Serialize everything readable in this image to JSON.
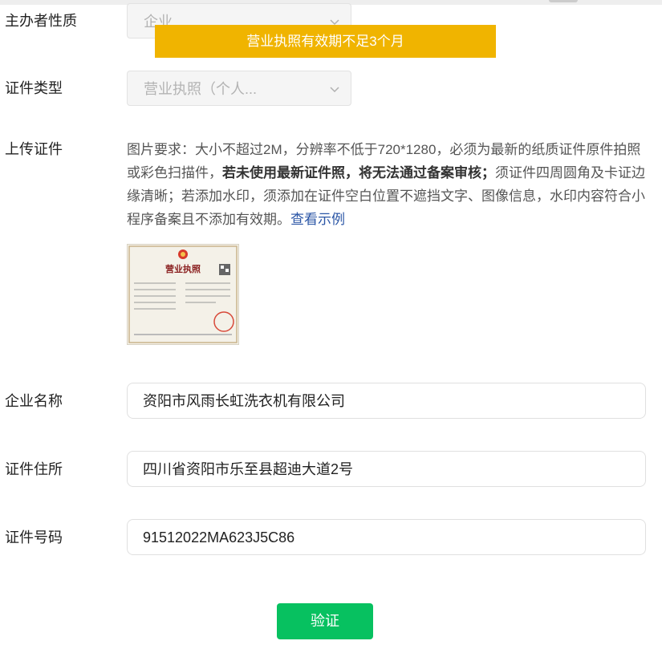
{
  "form": {
    "organizer_type": {
      "label": "主办者性质",
      "value": "企业"
    },
    "cert_type": {
      "label": "证件类型",
      "value": "营业执照（个人..."
    },
    "upload": {
      "label": "上传证件",
      "desc_part1": "图片要求：大小不超过2M，分辨率不低于720*1280，必须为最新的纸质证件原件拍照或彩色扫描件，",
      "desc_bold": "若未使用最新证件照，将无法通过备案审核；",
      "desc_part2": "须证件四周圆角及卡证边缘清晰；若添加水印，须添加在证件空白位置不遮挡文字、图像信息，水印内容符合小程序备案且不添加有效期。",
      "example_link": "查看示例",
      "thumb_title": "营业执照"
    },
    "company_name": {
      "label": "企业名称",
      "value": "资阳市风雨长虹洗衣机有限公司"
    },
    "cert_address": {
      "label": "证件住所",
      "value": "四川省资阳市乐至县超迪大道2号"
    },
    "cert_number": {
      "label": "证件号码",
      "value": "91512022MA623J5C86"
    }
  },
  "toast": {
    "message": "营业执照有效期不足3个月"
  },
  "actions": {
    "verify_label": "验证"
  },
  "colors": {
    "toast_bg": "#f0b400",
    "primary_button": "#07c160",
    "link": "#2b56a6"
  },
  "icons": {
    "select_chevron": "chevron-down-icon"
  }
}
